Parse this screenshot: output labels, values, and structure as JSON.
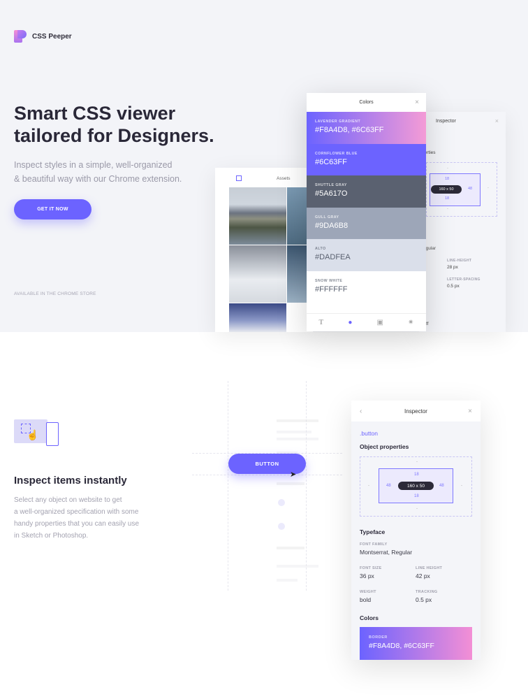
{
  "brand": {
    "name": "CSS Peeper"
  },
  "hero": {
    "title_line1": "Smart CSS viewer",
    "title_line2": "tailored for Designers.",
    "subtitle_line1": "Inspect styles in a simple, well-organized",
    "subtitle_line2": "& beautiful way with our Chrome extension.",
    "cta": "GET IT NOW",
    "store_note": "AVAILABLE IN THE CHROME STORE"
  },
  "assets_panel": {
    "title": "Assets"
  },
  "colors_panel": {
    "title": "Colors",
    "swatches": [
      {
        "name": "LAVENDER GRADIENT",
        "value": "#F8A4D8, #6C63FF",
        "bg": "linear-gradient(90deg,#6c63ff,#f49bd6)",
        "fg": "#ffffff"
      },
      {
        "name": "CORNFLOWER BLUE",
        "value": "#6C63FF",
        "bg": "#6c63ff",
        "fg": "#ffffff"
      },
      {
        "name": "SHUTTLE GRAY",
        "value": "#5A617O",
        "bg": "#5a6170",
        "fg": "#ffffff"
      },
      {
        "name": "GULL GRAY",
        "value": "#9DA6B8",
        "bg": "#9da6b8",
        "fg": "#ffffff"
      },
      {
        "name": "ALTO",
        "value": "#DADFEA",
        "bg": "#dadfea",
        "fg": "#5a6170"
      },
      {
        "name": "SNOW WHITE",
        "value": "#FFFFFF",
        "bg": "#ffffff",
        "fg": "#5a6170"
      }
    ],
    "tab_icons": [
      "text-icon",
      "color-drop-icon",
      "camera-icon",
      "gear-icon"
    ]
  },
  "inspector_back": {
    "title": "Inspector",
    "props_fragment": "perties",
    "box": {
      "width_height": "160 x 50",
      "top": "18",
      "bottom": "18",
      "side": "48",
      "outer_top": "-",
      "outer_side": "-"
    },
    "typeface_fragment": "egular",
    "line_height_label": "LINE-HEIGHT",
    "line_height_value": "28 px",
    "letter_spacing_label": "LETTER-SPACING",
    "letter_spacing_value": "0.5 px",
    "bottom_fragment": "ff"
  },
  "feature": {
    "title": "Inspect items instantly",
    "desc_line1": "Select any object on website to get",
    "desc_line2": "a well-organized specification with some",
    "desc_line3": "handy properties that you can easily use",
    "desc_line4": "in Sketch or Photoshop.",
    "demo_button": "BUTTON"
  },
  "inspector": {
    "title": "Inspector",
    "selector": ".button",
    "object_properties": "Object properties",
    "box": {
      "size": "160 x 50",
      "padding_top": "18",
      "padding_bottom": "18",
      "padding_left": "48",
      "padding_right": "48",
      "margin": "-"
    },
    "typeface": "Typeface",
    "font_family_label": "FONT FAMILY",
    "font_family": "Montserrat, Regular",
    "font_size_label": "FONT SIZE",
    "font_size": "36 px",
    "line_height_label": "LINE HEIGHT",
    "line_height": "42 px",
    "weight_label": "WEIGHT",
    "weight": "bold",
    "tracking_label": "TRACKING",
    "tracking": "0.5 px",
    "colors": "Colors",
    "border_label": "BORDER",
    "border_value": "#F8A4D8, #6C63FF"
  }
}
